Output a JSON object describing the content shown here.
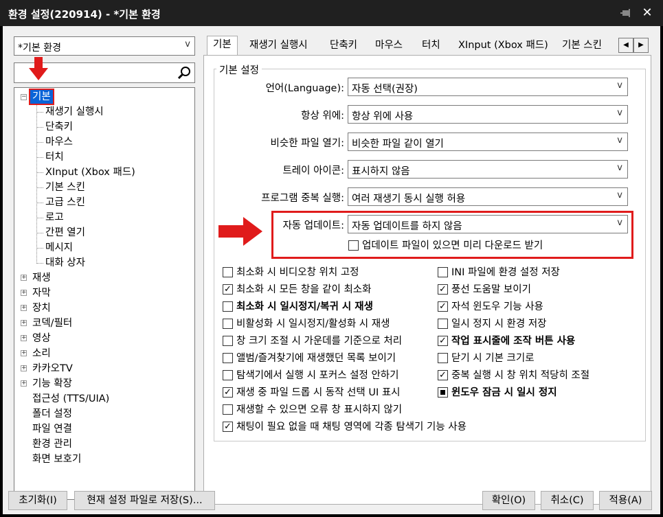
{
  "window": {
    "title": "환경 설정(220914) - *기본 환경"
  },
  "profile": {
    "selected": "*기본 환경"
  },
  "search": {
    "placeholder": ""
  },
  "tree": {
    "selected": "기본",
    "children": [
      "재생기 실행시",
      "단축키",
      "마우스",
      "터치",
      "XInput (Xbox 패드)",
      "기본 스킨",
      "고급 스킨",
      "로고",
      "간편 열기",
      "메시지",
      "대화 상자"
    ],
    "expandable": [
      "재생",
      "자막",
      "장치",
      "코덱/필터",
      "영상",
      "소리",
      "카카오TV",
      "기능 확장"
    ],
    "leaves": [
      "접근성 (TTS/UIA)",
      "폴더 설정",
      "파일 연결",
      "환경 관리",
      "화면 보호기"
    ]
  },
  "tabs": [
    "기본",
    "재생기 실행시",
    "단축키",
    "마우스",
    "터치",
    "XInput (Xbox 패드)",
    "기본 스킨"
  ],
  "group": {
    "title": "기본 설정",
    "settings": [
      {
        "label": "언어(Language):",
        "value": "자동 선택(권장)"
      },
      {
        "label": "항상 위에:",
        "value": "항상 위에 사용"
      },
      {
        "label": "비슷한 파일 열기:",
        "value": "비슷한 파일 같이 열기"
      },
      {
        "label": "트레이 아이콘:",
        "value": "표시하지 않음"
      },
      {
        "label": "프로그램 중복 실행:",
        "value": "여러 재생기 동시 실행 허용"
      },
      {
        "label": "자동 업데이트:",
        "value": "자동 업데이트를 하지 않음"
      }
    ],
    "update_download": {
      "label": "업데이트 파일이 있으면 미리 다운로드 받기",
      "checked": false
    }
  },
  "checkboxes_left": [
    {
      "label": "최소화 시 비디오창 위치 고정",
      "checked": false,
      "bold": false
    },
    {
      "label": "최소화 시 모든 창을 같이 최소화",
      "checked": true,
      "bold": false
    },
    {
      "label": "최소화 시 일시정지/복귀 시 재생",
      "checked": false,
      "bold": true
    },
    {
      "label": "비활성화 시 일시정지/활성화 시 재생",
      "checked": false,
      "bold": false
    },
    {
      "label": "창 크기 조절 시 가운데를 기준으로 처리",
      "checked": false,
      "bold": false
    },
    {
      "label": "앨범/즐겨찾기에 재생했던 목록 보이기",
      "checked": false,
      "bold": false
    },
    {
      "label": "탐색기에서 실행 시 포커스 설정 안하기",
      "checked": false,
      "bold": false
    },
    {
      "label": "재생 중 파일 드롭 시 동작 선택 UI 표시",
      "checked": true,
      "bold": false
    },
    {
      "label": "재생할 수 있으면 오류 창 표시하지 않기",
      "checked": false,
      "bold": false
    },
    {
      "label": "채팅이 필요 없을 때 채팅 영역에 각종 탐색기 기능 사용",
      "checked": true,
      "bold": false
    }
  ],
  "checkboxes_right": [
    {
      "label": "INI 파일에 환경 설정 저장",
      "checked": false,
      "bold": false
    },
    {
      "label": "풍선 도움말 보이기",
      "checked": true,
      "bold": false
    },
    {
      "label": "자석 윈도우 기능 사용",
      "checked": true,
      "bold": false
    },
    {
      "label": "일시 정지 시 환경 저장",
      "checked": false,
      "bold": false
    },
    {
      "label": "작업 표시줄에 조작 버튼 사용",
      "checked": true,
      "bold": true
    },
    {
      "label": "닫기 시 기본 크기로",
      "checked": false,
      "bold": false
    },
    {
      "label": "중복 실행 시 창 위치 적당히 조절",
      "checked": true,
      "bold": false
    },
    {
      "label": "윈도우 잠금 시 일시 정지",
      "checked": "indeterminate",
      "bold": true
    }
  ],
  "buttons": {
    "reset": "초기화(I)",
    "save_current": "현재 설정 파일로 저장(S)...",
    "ok": "확인(O)",
    "cancel": "취소(C)",
    "apply": "적용(A)"
  },
  "colors": {
    "selection": "#0a64d8",
    "highlight": "#e01b1b",
    "titlebar": "#202020"
  }
}
